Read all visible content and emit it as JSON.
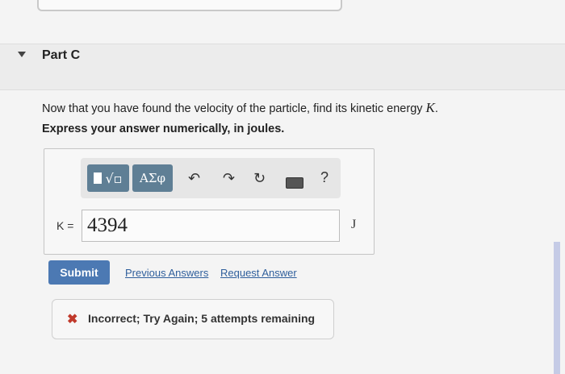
{
  "part": {
    "title": "Part C"
  },
  "question": {
    "text": "Now that you have found the velocity of the particle, find its kinetic energy ",
    "variable": "K",
    "trailing": ".",
    "instruction": "Express your answer numerically, in joules."
  },
  "toolbar": {
    "greek_label": "ΑΣφ",
    "help_label": "?",
    "icons": [
      "template-icon",
      "greek-icon",
      "undo-icon",
      "redo-icon",
      "reset-icon",
      "keyboard-icon",
      "help-icon"
    ]
  },
  "answer": {
    "label": "K =",
    "value": "4394",
    "unit": "J"
  },
  "actions": {
    "submit_label": "Submit",
    "previous_answers_label": "Previous Answers",
    "request_answer_label": "Request Answer"
  },
  "feedback": {
    "text": "Incorrect; Try Again; 5 attempts remaining",
    "status_color": "#c0392b"
  },
  "colors": {
    "primary_button": "#4c79b3",
    "toolbar_button": "#5f7f95",
    "link": "#2f5f9c"
  }
}
